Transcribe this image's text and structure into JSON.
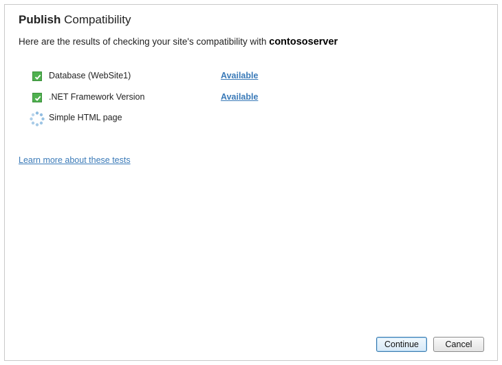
{
  "dialog": {
    "title_bold": "Publish",
    "title_rest": "Compatibility",
    "intro_text": "Here are the results of checking your site's compatibility with",
    "server_name": "contososerver"
  },
  "checks": [
    {
      "label": "Database (WebSite1)",
      "status": "Available",
      "state": "passed",
      "icon": "check-icon"
    },
    {
      "label": ".NET Framework Version",
      "status": "Available",
      "state": "passed",
      "icon": "check-icon"
    },
    {
      "label": "Simple HTML page",
      "status": "",
      "state": "in-progress",
      "icon": "spinner-icon"
    }
  ],
  "learn_more": "Learn more about these tests",
  "buttons": {
    "continue": "Continue",
    "cancel": "Cancel"
  },
  "colors": {
    "link": "#3a7ab8",
    "check_green": "#4fb14f",
    "spinner_blue": "#8dbbe0"
  }
}
